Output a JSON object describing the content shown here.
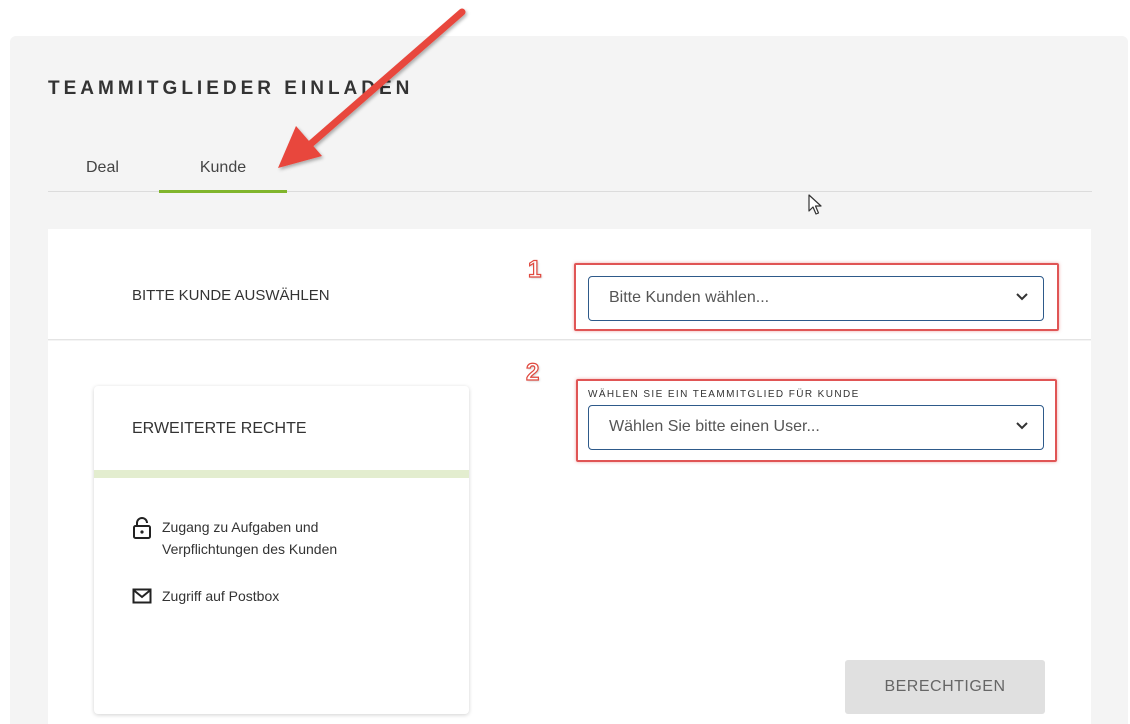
{
  "page": {
    "title": "TEAMMITGLIEDER EINLADEN"
  },
  "tabs": [
    {
      "label": "Deal",
      "active": false
    },
    {
      "label": "Kunde",
      "active": true
    }
  ],
  "customer_section": {
    "label": "BITTE KUNDE AUSWÄHLEN",
    "select": {
      "value": "Bitte Kunden wählen...",
      "icon": "chevron-down-icon"
    }
  },
  "member_section": {
    "caption": "WÄHLEN SIE EIN TEAMMITGLIED FÜR KUNDE",
    "select": {
      "value": "Wählen Sie bitte einen User...",
      "icon": "chevron-down-icon"
    }
  },
  "card": {
    "title": "ERWEITERTE RECHTE",
    "permissions": [
      {
        "icon": "lock-icon",
        "line1": "Zugang zu Aufgaben und",
        "line2": "Verpflichtungen des Kunden"
      },
      {
        "icon": "mail-icon",
        "line1": "Zugriff auf Postbox"
      }
    ]
  },
  "actions": {
    "submit_label": "BERECHTIGEN"
  },
  "annotations": {
    "marker_1": "1",
    "marker_2": "2",
    "highlight_color": "#e05555",
    "accent_color": "#80b52c"
  }
}
